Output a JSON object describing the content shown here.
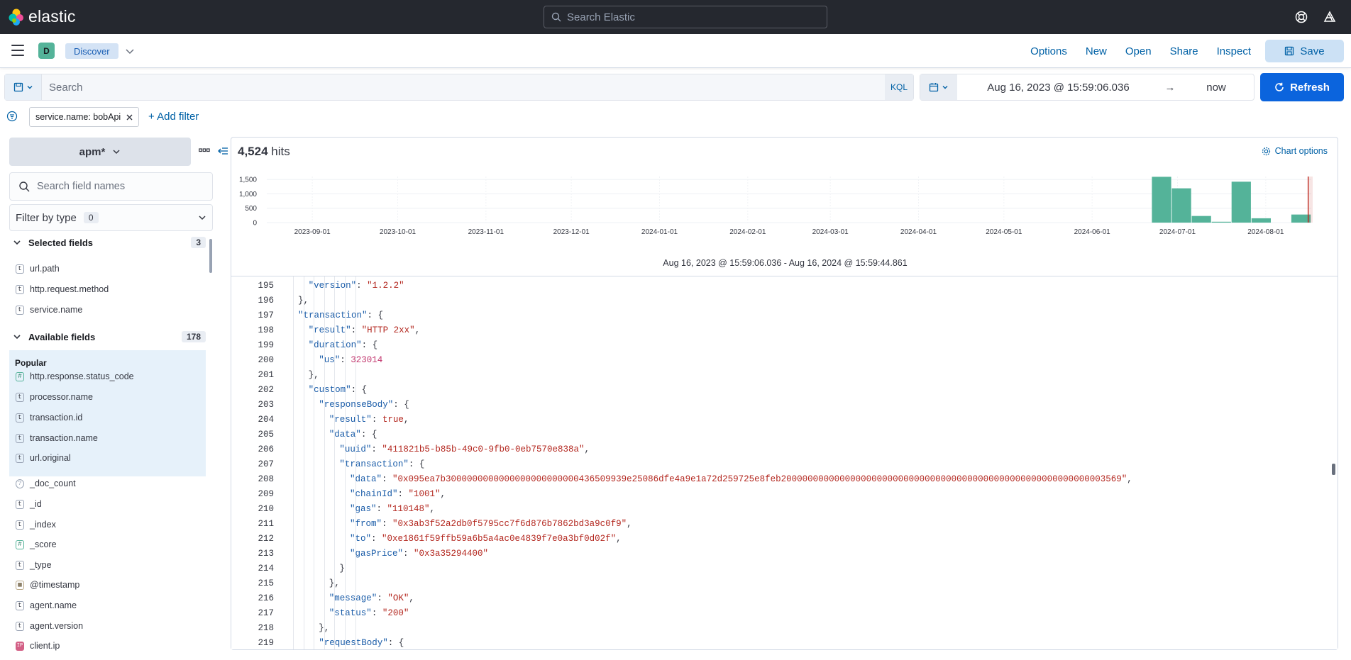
{
  "header": {
    "brand": "elastic",
    "search_placeholder": "Search Elastic"
  },
  "navbar": {
    "space_initial": "D",
    "breadcrumb": "Discover",
    "links": [
      "Options",
      "New",
      "Open",
      "Share",
      "Inspect"
    ],
    "save_label": "Save"
  },
  "query": {
    "placeholder": "Search",
    "language": "KQL"
  },
  "datepicker": {
    "start": "Aug 16, 2023 @ 15:59:06.036",
    "arrow": "→",
    "end": "now"
  },
  "refresh_label": "Refresh",
  "filters": {
    "pills": [
      {
        "label": "service.name: bobApi"
      }
    ],
    "add_label": "+ Add filter"
  },
  "sidebar": {
    "data_view": "apm*",
    "field_search_placeholder": "Search field names",
    "filter_by_type": "Filter by type",
    "filter_by_type_count": "0",
    "selected_header": "Selected fields",
    "selected_count": "3",
    "selected_fields": [
      {
        "type": "t",
        "name": "url.path"
      },
      {
        "type": "t",
        "name": "http.request.method"
      },
      {
        "type": "t",
        "name": "service.name"
      }
    ],
    "available_header": "Available fields",
    "available_count": "178",
    "popular_label": "Popular",
    "popular_fields": [
      {
        "type": "#",
        "name": "http.response.status_code"
      },
      {
        "type": "t",
        "name": "processor.name"
      },
      {
        "type": "t",
        "name": "transaction.id"
      },
      {
        "type": "t",
        "name": "transaction.name"
      },
      {
        "type": "t",
        "name": "url.original"
      }
    ],
    "other_fields": [
      {
        "type": "?",
        "name": "_doc_count"
      },
      {
        "type": "t",
        "name": "_id"
      },
      {
        "type": "t",
        "name": "_index"
      },
      {
        "type": "#",
        "name": "_score"
      },
      {
        "type": "t",
        "name": "_type"
      },
      {
        "type": "date",
        "name": "@timestamp"
      },
      {
        "type": "t",
        "name": "agent.name"
      },
      {
        "type": "t",
        "name": "agent.version"
      },
      {
        "type": "IP",
        "name": "client.ip"
      }
    ]
  },
  "results": {
    "hits_count": "4,524",
    "hits_label": "hits",
    "chart_options_label": "Chart options",
    "range_label": "Aug 16, 2023 @ 15:59:06.036 - Aug 16, 2024 @ 15:59:44.861"
  },
  "chart_data": {
    "type": "bar",
    "y_ticks": [
      "1,500",
      "1,000",
      "500",
      "0"
    ],
    "ylim": [
      0,
      1600
    ],
    "x_ticks": [
      "2023-09-01",
      "2023-10-01",
      "2023-11-01",
      "2023-12-01",
      "2024-01-01",
      "2024-02-01",
      "2024-03-01",
      "2024-04-01",
      "2024-05-01",
      "2024-06-01",
      "2024-07-01",
      "2024-08-01"
    ],
    "bars": [
      {
        "x": "2024-06-22",
        "value": 1590
      },
      {
        "x": "2024-06-29",
        "value": 1190
      },
      {
        "x": "2024-07-06",
        "value": 230
      },
      {
        "x": "2024-07-13",
        "value": 30
      },
      {
        "x": "2024-07-20",
        "value": 1420
      },
      {
        "x": "2024-07-27",
        "value": 150
      },
      {
        "x": "2024-08-10",
        "value": 280
      }
    ],
    "color": "#54b399",
    "now_marker": "2024-08-16"
  },
  "code": {
    "lines": [
      {
        "n": "195",
        "i": 1,
        "t": [
          [
            "k",
            "\"version\""
          ],
          [
            "p",
            ": "
          ],
          [
            "s",
            "\"1.2.2\""
          ]
        ]
      },
      {
        "n": "196",
        "i": 0,
        "t": [
          [
            "p",
            "},"
          ]
        ]
      },
      {
        "n": "197",
        "i": 0,
        "t": [
          [
            "k",
            "\"transaction\""
          ],
          [
            "p",
            ": {"
          ]
        ]
      },
      {
        "n": "198",
        "i": 1,
        "t": [
          [
            "k",
            "\"result\""
          ],
          [
            "p",
            ": "
          ],
          [
            "s",
            "\"HTTP 2xx\""
          ],
          [
            "p",
            ","
          ]
        ]
      },
      {
        "n": "199",
        "i": 1,
        "t": [
          [
            "k",
            "\"duration\""
          ],
          [
            "p",
            ": {"
          ]
        ]
      },
      {
        "n": "200",
        "i": 2,
        "t": [
          [
            "k",
            "\"us\""
          ],
          [
            "p",
            ": "
          ],
          [
            "n",
            "323014"
          ]
        ]
      },
      {
        "n": "201",
        "i": 1,
        "t": [
          [
            "p",
            "},"
          ]
        ]
      },
      {
        "n": "202",
        "i": 1,
        "t": [
          [
            "k",
            "\"custom\""
          ],
          [
            "p",
            ": {"
          ]
        ]
      },
      {
        "n": "203",
        "i": 2,
        "t": [
          [
            "k",
            "\"responseBody\""
          ],
          [
            "p",
            ": {"
          ]
        ]
      },
      {
        "n": "204",
        "i": 3,
        "t": [
          [
            "k",
            "\"result\""
          ],
          [
            "p",
            ": "
          ],
          [
            "b",
            "true"
          ],
          [
            "p",
            ","
          ]
        ]
      },
      {
        "n": "205",
        "i": 3,
        "t": [
          [
            "k",
            "\"data\""
          ],
          [
            "p",
            ": {"
          ]
        ]
      },
      {
        "n": "206",
        "i": 4,
        "t": [
          [
            "k",
            "\"uuid\""
          ],
          [
            "p",
            ": "
          ],
          [
            "s",
            "\"411821b5-b85b-49c0-9fb0-0eb7570e838a\""
          ],
          [
            "p",
            ","
          ]
        ]
      },
      {
        "n": "207",
        "i": 4,
        "t": [
          [
            "k",
            "\"transaction\""
          ],
          [
            "p",
            ": {"
          ]
        ]
      },
      {
        "n": "208",
        "i": 5,
        "t": [
          [
            "k",
            "\"data\""
          ],
          [
            "p",
            ": "
          ],
          [
            "s",
            "\"0x095ea7b3000000000000000000000000436509939e25086dfe4a9e1a72d259725e8feb2000000000000000000000000000000000000000000000000000000000003569\""
          ],
          [
            "p",
            ","
          ]
        ]
      },
      {
        "n": "209",
        "i": 5,
        "t": [
          [
            "k",
            "\"chainId\""
          ],
          [
            "p",
            ": "
          ],
          [
            "s",
            "\"1001\""
          ],
          [
            "p",
            ","
          ]
        ]
      },
      {
        "n": "210",
        "i": 5,
        "t": [
          [
            "k",
            "\"gas\""
          ],
          [
            "p",
            ": "
          ],
          [
            "s",
            "\"110148\""
          ],
          [
            "p",
            ","
          ]
        ]
      },
      {
        "n": "211",
        "i": 5,
        "t": [
          [
            "k",
            "\"from\""
          ],
          [
            "p",
            ": "
          ],
          [
            "s",
            "\"0x3ab3f52a2db0f5795cc7f6d876b7862bd3a9c0f9\""
          ],
          [
            "p",
            ","
          ]
        ]
      },
      {
        "n": "212",
        "i": 5,
        "t": [
          [
            "k",
            "\"to\""
          ],
          [
            "p",
            ": "
          ],
          [
            "s",
            "\"0xe1861f59ffb59a6b5a4ac0e4839f7e0a3bf0d02f\""
          ],
          [
            "p",
            ","
          ]
        ]
      },
      {
        "n": "213",
        "i": 5,
        "t": [
          [
            "k",
            "\"gasPrice\""
          ],
          [
            "p",
            ": "
          ],
          [
            "s",
            "\"0x3a35294400\""
          ]
        ]
      },
      {
        "n": "214",
        "i": 4,
        "t": [
          [
            "p",
            "}"
          ]
        ]
      },
      {
        "n": "215",
        "i": 3,
        "t": [
          [
            "p",
            "},"
          ]
        ]
      },
      {
        "n": "216",
        "i": 3,
        "t": [
          [
            "k",
            "\"message\""
          ],
          [
            "p",
            ": "
          ],
          [
            "s",
            "\"OK\""
          ],
          [
            "p",
            ","
          ]
        ]
      },
      {
        "n": "217",
        "i": 3,
        "t": [
          [
            "k",
            "\"status\""
          ],
          [
            "p",
            ": "
          ],
          [
            "s",
            "\"200\""
          ]
        ]
      },
      {
        "n": "218",
        "i": 2,
        "t": [
          [
            "p",
            "},"
          ]
        ]
      },
      {
        "n": "219",
        "i": 2,
        "t": [
          [
            "k",
            "\"requestBody\""
          ],
          [
            "p",
            ": {"
          ]
        ]
      }
    ]
  }
}
